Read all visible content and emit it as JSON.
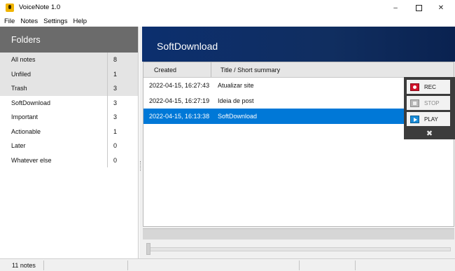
{
  "window": {
    "title": "VoiceNote 1.0",
    "icon": "microphone-app-icon",
    "controls": {
      "minimize": "–",
      "close": "✕"
    }
  },
  "menu": [
    "File",
    "Notes",
    "Settings",
    "Help"
  ],
  "sidebar": {
    "header": "Folders",
    "folders": [
      {
        "name": "All notes",
        "count": "8"
      },
      {
        "name": "Unfiled",
        "count": "1"
      },
      {
        "name": "Trash",
        "count": "3"
      },
      {
        "name": "SoftDownload",
        "count": "3"
      },
      {
        "name": "Important",
        "count": "3"
      },
      {
        "name": "Actionable",
        "count": "1"
      },
      {
        "name": "Later",
        "count": "0"
      },
      {
        "name": "Whatever else",
        "count": "0"
      }
    ]
  },
  "main": {
    "folder_title": "SoftDownload",
    "columns": {
      "created": "Created",
      "title": "Title / Short summary"
    },
    "notes": [
      {
        "created": "2022-04-15, 16:27:43",
        "title": "Atualizar site",
        "selected": false
      },
      {
        "created": "2022-04-15, 16:27:19",
        "title": "Ideia de post",
        "selected": false
      },
      {
        "created": "2022-04-15, 16:13:38",
        "title": "SoftDownload",
        "selected": true
      }
    ],
    "seek_position": 0
  },
  "player": {
    "rec": "REC",
    "stop": "STOP",
    "play": "PLAY",
    "close": "✖"
  },
  "status": {
    "text": "11 notes"
  },
  "colors": {
    "accent_selection": "#0078d7",
    "banner": "#0c2f6e",
    "sidebar_header": "#6b6b6b",
    "rec": "#d1132a",
    "play": "#1a8cd8"
  }
}
